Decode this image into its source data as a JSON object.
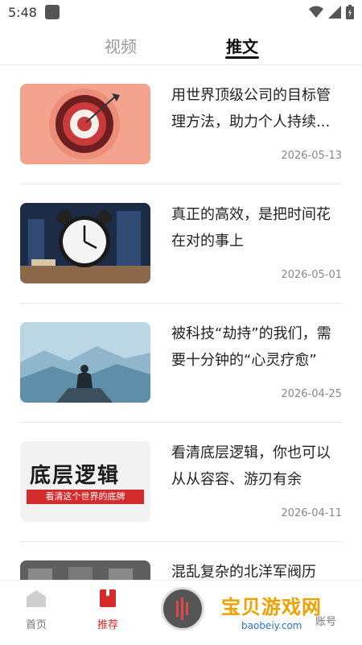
{
  "status": {
    "time": "5:48"
  },
  "tabs": [
    {
      "label": "视频"
    },
    {
      "label": "推文"
    }
  ],
  "articles": [
    {
      "title": "用世界顶级公司的目标管理方法，助力个人持续...",
      "date": "2026-05-13",
      "thumb_icon": "target-image"
    },
    {
      "title": "真正的高效，是把时间花在对的事上",
      "date": "2026-05-01",
      "thumb_icon": "alarm-clock-image"
    },
    {
      "title": "被科技“劫持”的我们，需要十分钟的“心灵疗愈”",
      "date": "2026-04-25",
      "thumb_icon": "meditation-mountain-image"
    },
    {
      "title": "看清底层逻辑，你也可以从从容容、游刃有余",
      "date": "2026-04-11",
      "thumb_icon": "logic-poster-image",
      "thumb_text": "底层逻辑",
      "thumb_subtext": "看清这个世界的底牌"
    },
    {
      "title": "混乱复杂的北洋军阀历",
      "date": "",
      "thumb_icon": "history-photo-image"
    }
  ],
  "bottom_nav": {
    "home": "首页",
    "recommend": "推荐",
    "account": "账号"
  },
  "watermark": {
    "text": "宝贝游戏网",
    "url": "baobeiy.com"
  },
  "colors": {
    "accent": "#d52b2b",
    "text": "#222222",
    "muted": "#888888"
  }
}
